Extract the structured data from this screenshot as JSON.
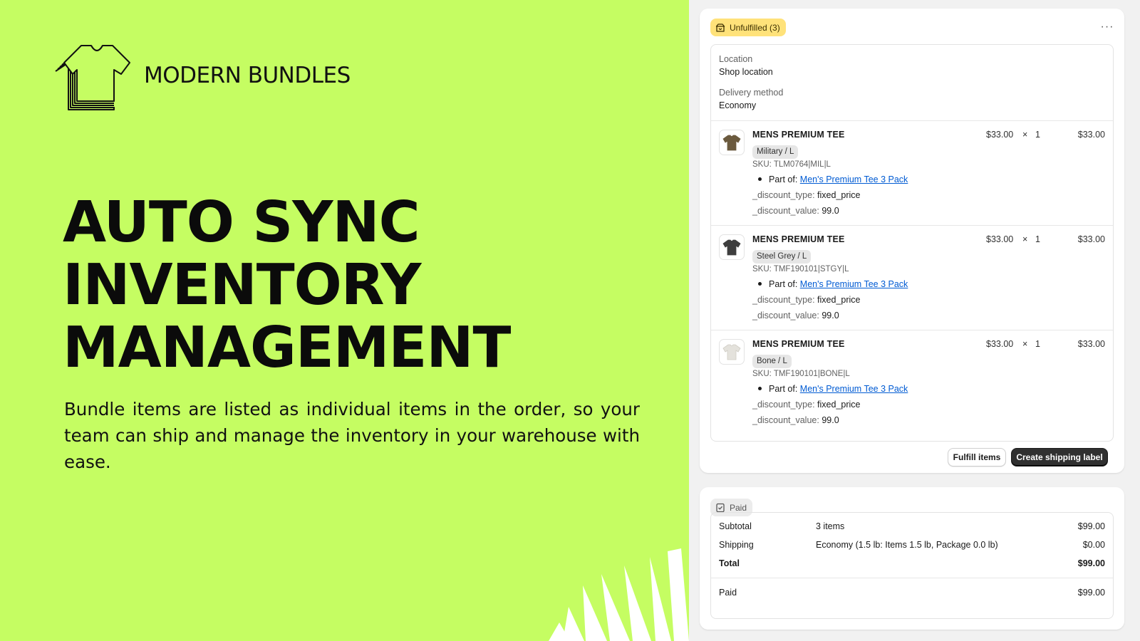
{
  "brand": {
    "name": "MODERN BUNDLES"
  },
  "hero": {
    "headline": [
      "AUTO SYNC",
      "INVENTORY",
      "MANAGEMENT"
    ],
    "subtext": "Bundle items are listed as individual items in the order, so your team can ship and manage the inventory in your warehouse with ease."
  },
  "colors": {
    "hero_bg": "#c5fd62",
    "unfulfilled_badge": "#ffe27a",
    "link": "#005bd3",
    "primary_button": "#303030"
  },
  "fulfillment": {
    "badge_icon": "package-icon",
    "badge_label": "Unfulfilled (3)",
    "more_icon": "more-horizontal-icon",
    "more_label": "···",
    "location_label": "Location",
    "location_value": "Shop location",
    "delivery_label": "Delivery method",
    "delivery_value": "Economy",
    "items": [
      {
        "name": "MENS PREMIUM TEE",
        "variant": "Military / L",
        "sku": "SKU: TLM0764|MIL|L",
        "part_of_label": "Part of:",
        "part_of_link": "Men's Premium Tee 3 Pack",
        "discount_type_key": "_discount_type:",
        "discount_type_value": "fixed_price",
        "discount_value_key": "_discount_value:",
        "discount_value_value": "99.0",
        "price": "$33.00",
        "times": "×",
        "qty": "1",
        "total": "$33.00",
        "color": "#6b5a3e",
        "icon": "tshirt-icon"
      },
      {
        "name": "MENS PREMIUM TEE",
        "variant": "Steel Grey / L",
        "sku": "SKU: TMF190101|STGY|L",
        "part_of_label": "Part of:",
        "part_of_link": "Men's Premium Tee 3 Pack",
        "discount_type_key": "_discount_type:",
        "discount_type_value": "fixed_price",
        "discount_value_key": "_discount_value:",
        "discount_value_value": "99.0",
        "price": "$33.00",
        "times": "×",
        "qty": "1",
        "total": "$33.00",
        "color": "#3e3e3e",
        "icon": "tshirt-icon"
      },
      {
        "name": "MENS PREMIUM TEE",
        "variant": "Bone / L",
        "sku": "SKU: TMF190101|BONE|L",
        "part_of_label": "Part of:",
        "part_of_link": "Men's Premium Tee 3 Pack",
        "discount_type_key": "_discount_type:",
        "discount_type_value": "fixed_price",
        "discount_value_key": "_discount_value:",
        "discount_value_value": "99.0",
        "price": "$33.00",
        "times": "×",
        "qty": "1",
        "total": "$33.00",
        "color": "#e4e2dc",
        "icon": "tshirt-icon"
      }
    ],
    "fulfill_button": "Fulfill items",
    "shipping_label_button": "Create shipping label"
  },
  "payment": {
    "badge_icon": "receipt-check-icon",
    "badge_label": "Paid",
    "subtotal_label": "Subtotal",
    "subtotal_desc": "3 items",
    "subtotal_amount": "$99.00",
    "shipping_label": "Shipping",
    "shipping_desc": "Economy (1.5 lb: Items 1.5 lb, Package 0.0 lb)",
    "shipping_amount": "$0.00",
    "total_label": "Total",
    "total_amount": "$99.00",
    "paid_label": "Paid",
    "paid_amount": "$99.00"
  }
}
